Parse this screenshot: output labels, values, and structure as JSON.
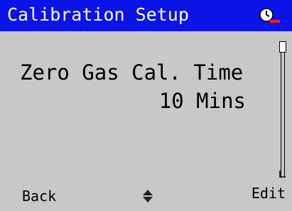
{
  "title_bar": {
    "title": "Calibration Setup",
    "background_color": "#0a14e6",
    "status_icon": "clock-alarm-icon"
  },
  "parameter": {
    "name": "Zero Gas Cal. Time",
    "value": "10 Mins"
  },
  "scrollbar": {
    "icon": "vertical-scrollbar"
  },
  "softkeys": {
    "left_label": "Back",
    "center_icon": "up-down-arrows-icon",
    "right_label": "Edit"
  }
}
